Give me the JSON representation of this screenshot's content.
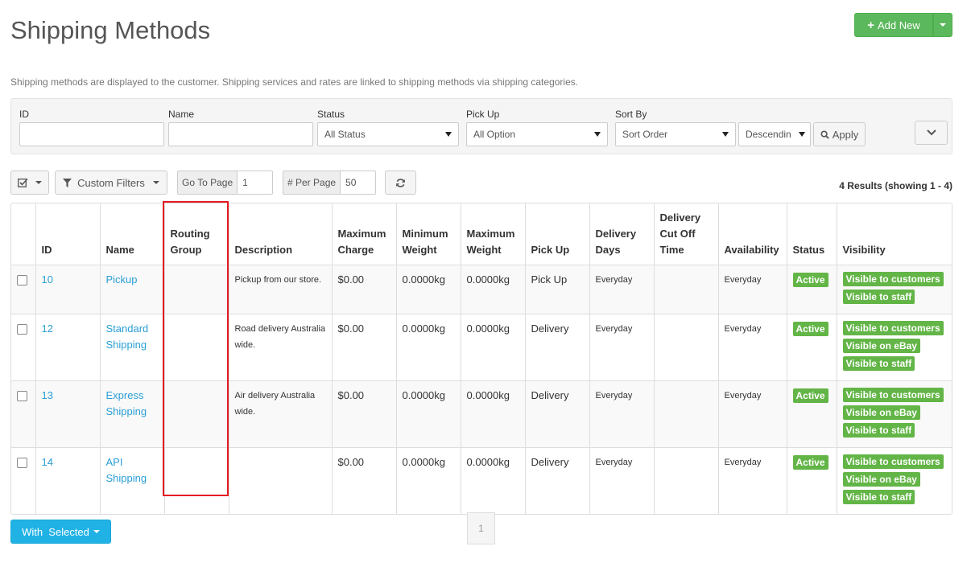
{
  "header": {
    "title": "Shipping Methods",
    "add_new": "Add New",
    "description": "Shipping methods are displayed to the customer. Shipping services and rates are linked to shipping methods via shipping categories."
  },
  "filters": {
    "id_label": "ID",
    "id_value": "",
    "name_label": "Name",
    "name_value": "",
    "status_label": "Status",
    "status_value": "All Status",
    "pickup_label": "Pick Up",
    "pickup_value": "All Option",
    "sortby_label": "Sort By",
    "sortby_value": "Sort Order",
    "order_value": "Descendin",
    "apply": "Apply"
  },
  "toolbar": {
    "custom_filters": "Custom Filters",
    "goto_label": "Go To Page",
    "goto_value": "1",
    "perpage_label": "# Per Page",
    "perpage_value": "50",
    "results": "4 Results (showing 1 - 4)"
  },
  "table": {
    "headers": {
      "id": "ID",
      "name": "Name",
      "routing1": "Routing",
      "routing2": "Group",
      "description": "Description",
      "maxcharge1": "Maximum",
      "maxcharge2": "Charge",
      "minweight1": "Minimum",
      "minweight2": "Weight",
      "maxweight1": "Maximum",
      "maxweight2": "Weight",
      "pickup": "Pick Up",
      "deldays1": "Delivery",
      "deldays2": "Days",
      "cutoff1": "Delivery",
      "cutoff2": "Cut Off",
      "cutoff3": "Time",
      "availability": "Availability",
      "status": "Status",
      "visibility": "Visibility"
    },
    "rows": [
      {
        "id": "10",
        "name1": "Pickup",
        "name2": "",
        "routing": "",
        "desc1": "Pickup from our store.",
        "desc2": "",
        "max_charge": "$0.00",
        "min_weight": "0.0000kg",
        "max_weight": "0.0000kg",
        "pickup": "Pick Up",
        "delivery_days": "Everyday",
        "cutoff": "",
        "availability": "Everyday",
        "status": "Active",
        "vis": [
          "Visible to customers",
          "Visible to staff"
        ]
      },
      {
        "id": "12",
        "name1": "Standard",
        "name2": "Shipping",
        "routing": "",
        "desc1": "Road delivery Australia",
        "desc2": "wide.",
        "max_charge": "$0.00",
        "min_weight": "0.0000kg",
        "max_weight": "0.0000kg",
        "pickup": "Delivery",
        "delivery_days": "Everyday",
        "cutoff": "",
        "availability": "Everyday",
        "status": "Active",
        "vis": [
          "Visible to customers",
          "Visible on eBay",
          "Visible to staff"
        ]
      },
      {
        "id": "13",
        "name1": "Express",
        "name2": "Shipping",
        "routing": "",
        "desc1": "Air delivery Australia",
        "desc2": "wide.",
        "max_charge": "$0.00",
        "min_weight": "0.0000kg",
        "max_weight": "0.0000kg",
        "pickup": "Delivery",
        "delivery_days": "Everyday",
        "cutoff": "",
        "availability": "Everyday",
        "status": "Active",
        "vis": [
          "Visible to customers",
          "Visible on eBay",
          "Visible to staff"
        ]
      },
      {
        "id": "14",
        "name1": "API",
        "name2": "Shipping",
        "routing": "",
        "desc1": "",
        "desc2": "",
        "max_charge": "$0.00",
        "min_weight": "0.0000kg",
        "max_weight": "0.0000kg",
        "pickup": "Delivery",
        "delivery_days": "Everyday",
        "cutoff": "",
        "availability": "Everyday",
        "status": "Active",
        "vis": [
          "Visible to customers",
          "Visible on eBay",
          "Visible to staff"
        ]
      }
    ]
  },
  "footer": {
    "with_selected": "With  Selected",
    "page": "1"
  },
  "colors": {
    "accent_green": "#5cb85c",
    "label_green": "#62b546",
    "link_blue": "#2a9fd6",
    "with_selected_blue": "#21b2e5",
    "highlight_red": "#e31b23"
  }
}
